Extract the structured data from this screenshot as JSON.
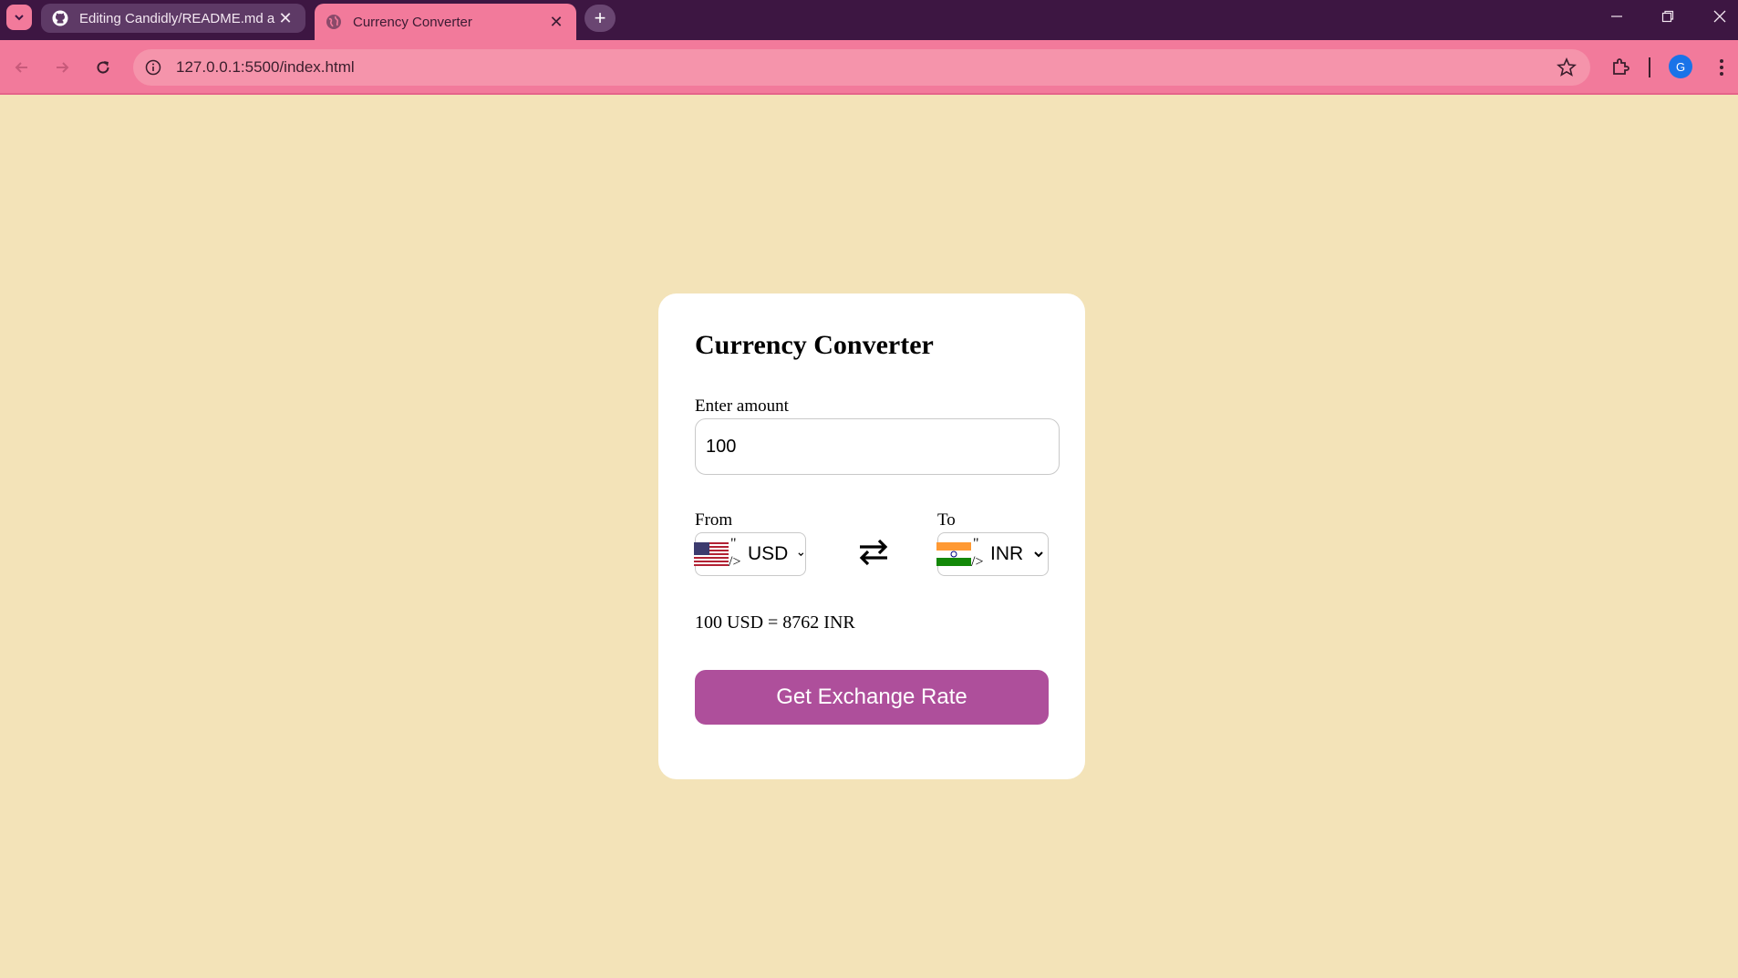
{
  "browser": {
    "tabs": [
      {
        "title": "Editing Candidly/README.md a",
        "favicon": "github-icon"
      },
      {
        "title": "Currency Converter",
        "favicon": "globe-icon"
      }
    ],
    "url": "127.0.0.1:5500/index.html",
    "profile_initial": "G",
    "colors": {
      "tabstrip": "#3d1642",
      "toolbar": "#f27a9b",
      "omnibox": "#f594ab"
    }
  },
  "app": {
    "title": "Currency Converter",
    "amount_label": "Enter amount",
    "amount_value": "100",
    "from_label": "From",
    "to_label": "To",
    "from_currency": "USD",
    "to_currency": "INR",
    "from_flag": "us-flag-icon",
    "to_flag": "india-flag-icon",
    "stray_quote": "\"",
    "stray_slash": "/>",
    "result": "100 USD = 8762 INR",
    "button_label": "Get Exchange Rate",
    "colors": {
      "background": "#f3e3b8",
      "button": "#ae4f9b",
      "card": "#ffffff"
    }
  }
}
